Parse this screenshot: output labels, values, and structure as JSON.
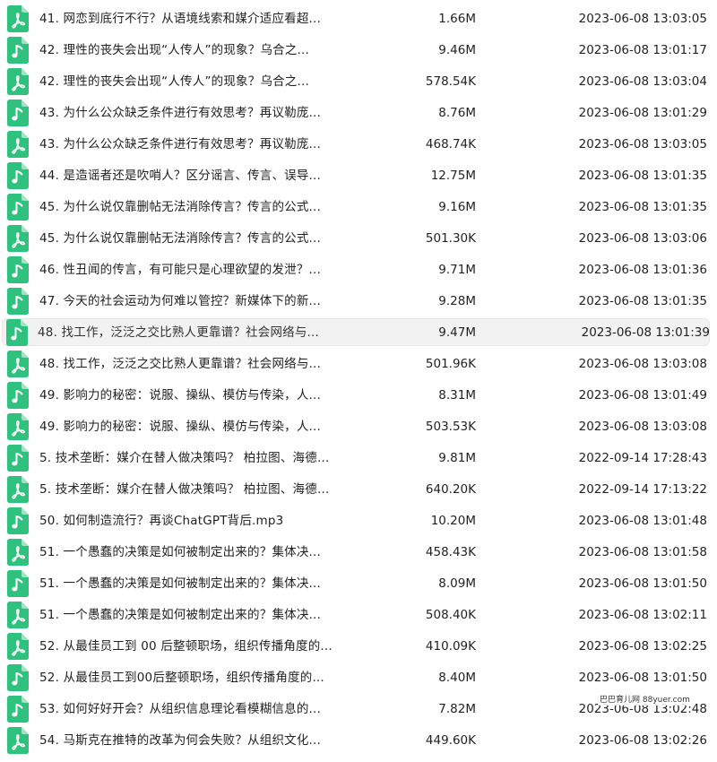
{
  "colors": {
    "icon_green": "#2ec27e",
    "selected_bg": "#f2f2f2",
    "text": "#222222"
  },
  "files": [
    {
      "name": "41. 网恋到底行不行？从语境线索和媒介适应看超...",
      "size": "1.66M",
      "date": "2023-06-08 13:03:05",
      "icon": "pdf-icon"
    },
    {
      "name": "42. 理性的丧失会出现“人传人”的现象？乌合之...",
      "size": "9.46M",
      "date": "2023-06-08 13:01:17",
      "icon": "audio-icon"
    },
    {
      "name": "42. 理性的丧失会出现“人传人”的现象？乌合之...",
      "size": "578.54K",
      "date": "2023-06-08 13:03:04",
      "icon": "pdf-icon"
    },
    {
      "name": "43. 为什么公众缺乏条件进行有效思考？再议勒庞...",
      "size": "8.76M",
      "date": "2023-06-08 13:01:29",
      "icon": "audio-icon"
    },
    {
      "name": "43. 为什么公众缺乏条件进行有效思考？再议勒庞...",
      "size": "468.74K",
      "date": "2023-06-08 13:03:05",
      "icon": "pdf-icon"
    },
    {
      "name": "44. 是造谣者还是吹哨人？区分谣言、传言、误导...",
      "size": "12.75M",
      "date": "2023-06-08 13:01:35",
      "icon": "audio-icon"
    },
    {
      "name": "45. 为什么说仅靠删帖无法消除传言？传言的公式...",
      "size": "9.16M",
      "date": "2023-06-08 13:01:35",
      "icon": "audio-icon"
    },
    {
      "name": "45. 为什么说仅靠删帖无法消除传言？传言的公式...",
      "size": "501.30K",
      "date": "2023-06-08 13:03:06",
      "icon": "pdf-icon"
    },
    {
      "name": "46. 性丑闻的传言，有可能只是心理欲望的发泄？...",
      "size": "9.71M",
      "date": "2023-06-08 13:01:36",
      "icon": "audio-icon"
    },
    {
      "name": "47. 今天的社会运动为何难以管控？新媒体下的新...",
      "size": "9.28M",
      "date": "2023-06-08 13:01:35",
      "icon": "audio-icon"
    },
    {
      "name": "48. 找工作，泛泛之交比熟人更靠谱？社会网络与...",
      "size": "9.47M",
      "date": "2023-06-08 13:01:39",
      "icon": "audio-icon",
      "selected": true
    },
    {
      "name": "48. 找工作，泛泛之交比熟人更靠谱？社会网络与...",
      "size": "501.96K",
      "date": "2023-06-08 13:03:08",
      "icon": "pdf-icon"
    },
    {
      "name": "49. 影响力的秘密：说服、操纵、模仿与传染，人...",
      "size": "8.31M",
      "date": "2023-06-08 13:01:49",
      "icon": "audio-icon"
    },
    {
      "name": "49. 影响力的秘密：说服、操纵、模仿与传染，人...",
      "size": "503.53K",
      "date": "2023-06-08 13:03:08",
      "icon": "pdf-icon"
    },
    {
      "name": "5. 技术垄断：媒介在替人做决策吗？ 柏拉图、海德...",
      "size": "9.81M",
      "date": "2022-09-14 17:28:43",
      "icon": "audio-icon"
    },
    {
      "name": "5. 技术垄断：媒介在替人做决策吗？ 柏拉图、海德...",
      "size": "640.20K",
      "date": "2022-09-14 17:13:22",
      "icon": "pdf-icon"
    },
    {
      "name": "50. 如何制造流行？再谈ChatGPT背后.mp3",
      "size": "10.20M",
      "date": "2023-06-08 13:01:48",
      "icon": "audio-icon"
    },
    {
      "name": "51. 一个愚蠢的决策是如何被制定出来的？集体决...",
      "size": "458.43K",
      "date": "2023-06-08 13:01:58",
      "icon": "pdf-icon"
    },
    {
      "name": "51. 一个愚蠢的决策是如何被制定出来的？集体决...",
      "size": "8.09M",
      "date": "2023-06-08 13:01:50",
      "icon": "audio-icon"
    },
    {
      "name": "51. 一个愚蠢的决策是如何被制定出来的？集体决...",
      "size": "508.40K",
      "date": "2023-06-08 13:02:11",
      "icon": "pdf-icon"
    },
    {
      "name": "52. 从最佳员工到 00 后整顿职场，组织传播角度的...",
      "size": "410.09K",
      "date": "2023-06-08 13:02:25",
      "icon": "pdf-icon"
    },
    {
      "name": "52. 从最佳员工到00后整顿职场，组织传播角度的...",
      "size": "8.40M",
      "date": "2023-06-08 13:01:50",
      "icon": "audio-icon"
    },
    {
      "name": "53. 如何好好开会？从组织信息理论看模糊信息的...",
      "size": "7.82M",
      "date": "2023-06-08 13:02:48",
      "icon": "audio-icon"
    },
    {
      "name": "54. 马斯克在推特的改革为何会失败？从组织文化...",
      "size": "449.60K",
      "date": "2023-06-08 13:02:26",
      "icon": "pdf-icon"
    }
  ],
  "watermark": "巴巴育儿网 88yuer.com"
}
